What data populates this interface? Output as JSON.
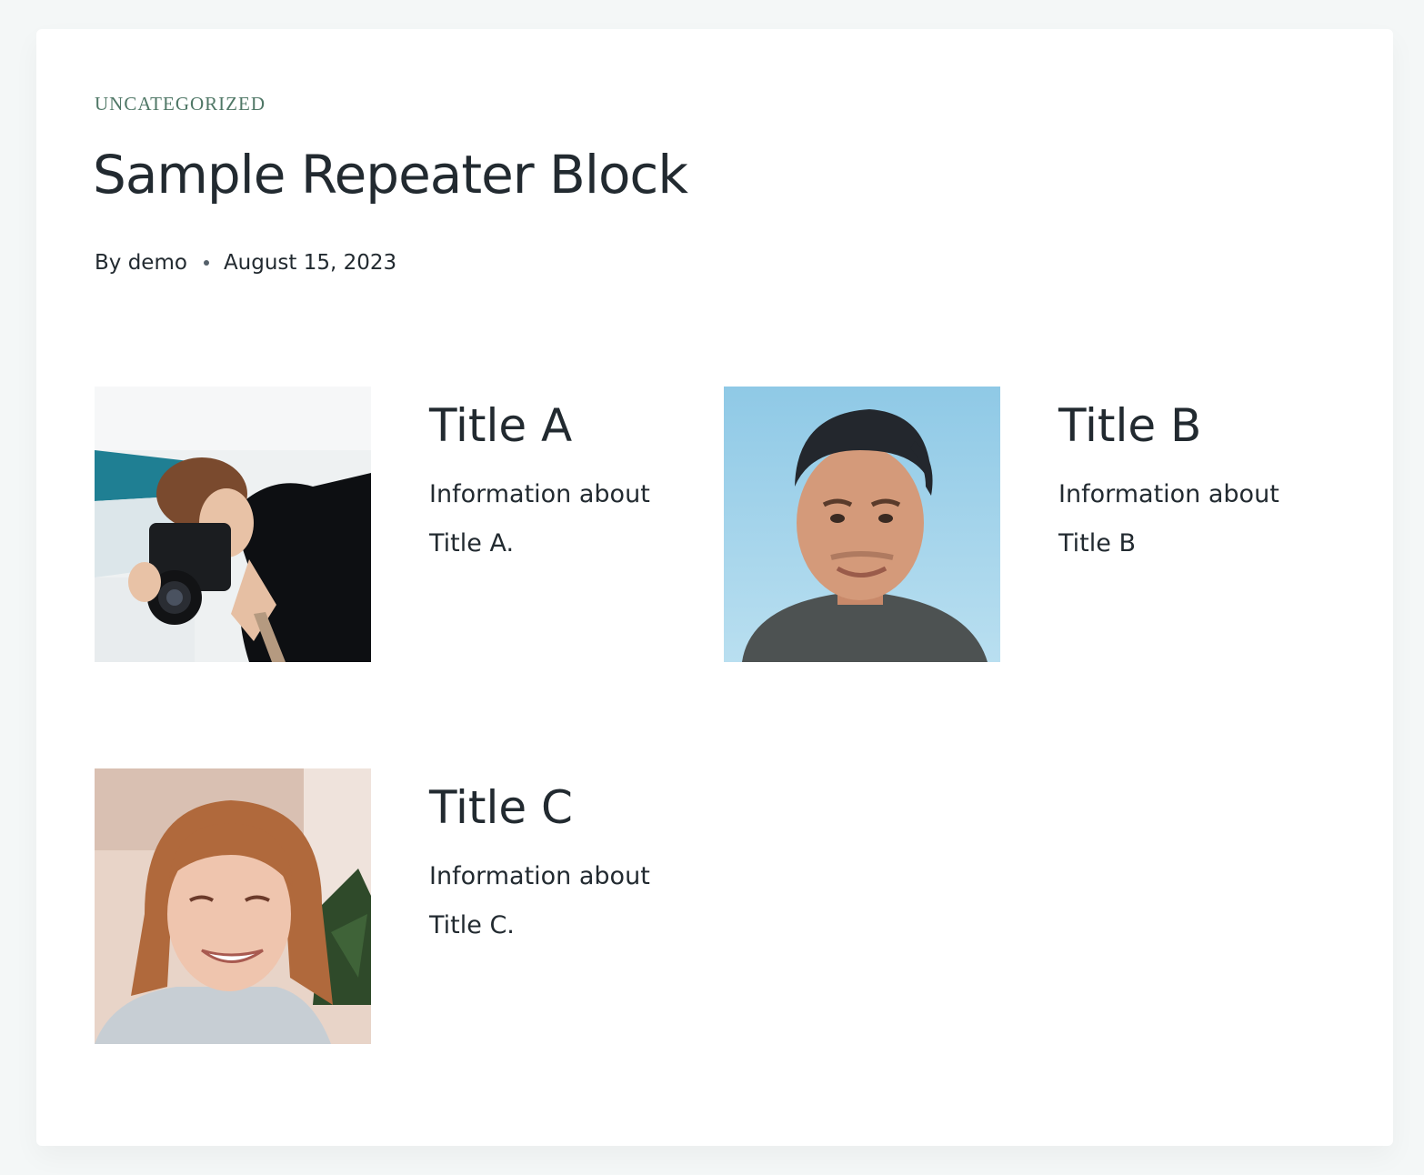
{
  "post": {
    "category": "UNCATEGORIZED",
    "title": "Sample Repeater Block",
    "author": "By demo",
    "date": "August 15, 2023"
  },
  "items": [
    {
      "title": "Title A",
      "text": "Information about Title A.",
      "image_icon": "photographer-photo"
    },
    {
      "title": "Title B",
      "text": "Information about Title B",
      "image_icon": "man-portrait-photo"
    },
    {
      "title": "Title C",
      "text": "Information about Title C.",
      "image_icon": "woman-portrait-photo"
    }
  ],
  "colors": {
    "page_background": "#f4f7f7",
    "card_background": "#ffffff",
    "category": "#4f7766",
    "text": "#222a30"
  }
}
